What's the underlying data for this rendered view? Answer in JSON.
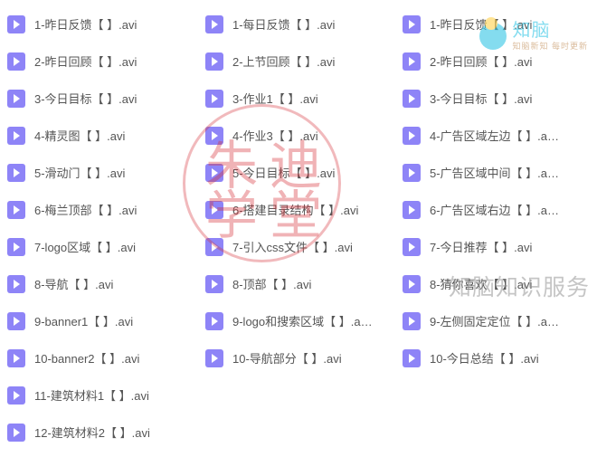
{
  "columns": [
    [
      "1-昨日反馈【  】.avi",
      "2-昨日回顾【  】.avi",
      "3-今日目标【  】.avi",
      "4-精灵图【  】.avi",
      "5-滑动门【  】.avi",
      "6-梅兰顶部【  】.avi",
      "7-logo区域【  】.avi",
      "8-导航【  】.avi",
      "9-banner1【  】.avi",
      "10-banner2【  】.avi",
      "11-建筑材料1【  】.avi",
      "12-建筑材料2【  】.avi"
    ],
    [
      "1-每日反馈【  】.avi",
      "2-上节回顾【  】.avi",
      "3-作业1【  】.avi",
      "4-作业3【  】.avi",
      "5-今日目标【  】.avi",
      "6-搭建目录结构【  】.avi",
      "7-引入css文件【  】.avi",
      "8-顶部【  】.avi",
      "9-logo和搜索区域【  】.a…",
      "10-导航部分【  】.avi"
    ],
    [
      "1-昨日反馈【  】.avi",
      "2-昨日回顾【  】.avi",
      "3-今日目标【  】.avi",
      "4-广告区域左边【  】.a…",
      "5-广告区域中间【  】.a…",
      "6-广告区域右边【  】.a…",
      "7-今日推荐【  】.avi",
      "8-猜你喜欢【  】.avi",
      "9-左侧固定定位【  】.a…",
      "10-今日总结【  】.avi"
    ]
  ],
  "stamp": {
    "c1": "朱",
    "c2": "迪",
    "c3": "学",
    "c4": "堂"
  },
  "brand": {
    "name": "知脑",
    "sub": "知脑新知 每时更新"
  },
  "watermark": "知脑知识服务"
}
